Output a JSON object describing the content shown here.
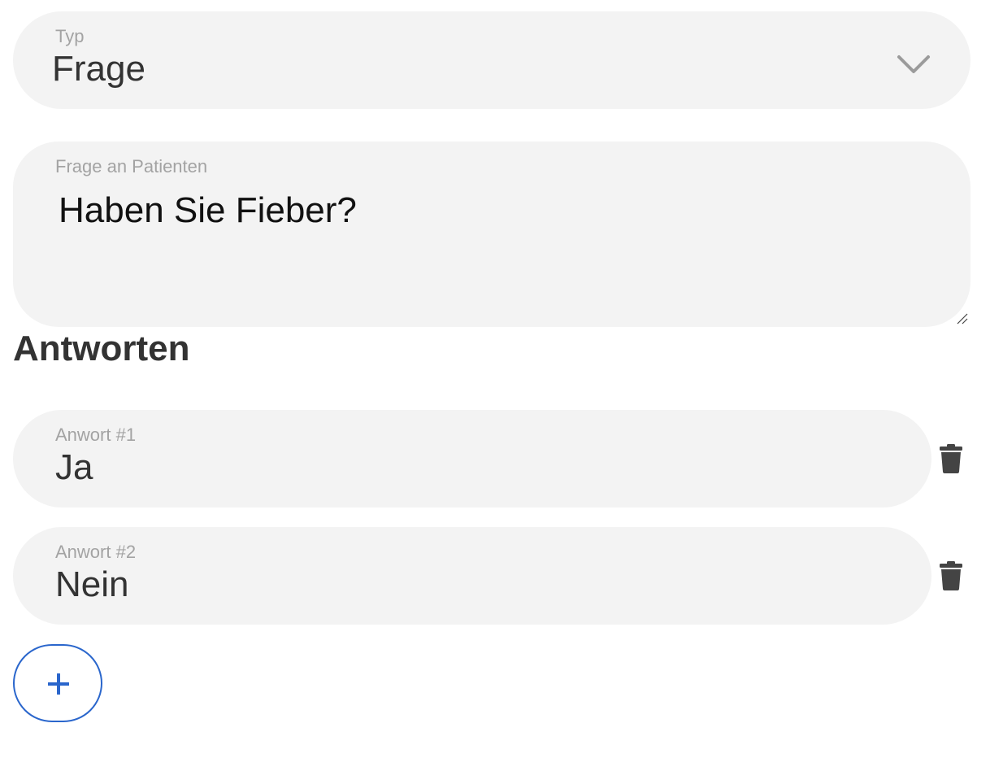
{
  "type_select": {
    "label": "Typ",
    "value": "Frage",
    "icon": "chevron-down-icon"
  },
  "question": {
    "label": "Frage an Patienten",
    "value": "Haben Sie Fieber?"
  },
  "answers_section": {
    "heading": "Antworten"
  },
  "answers": [
    {
      "label": "Anwort #1",
      "value": "Ja",
      "delete_icon": "trash-icon"
    },
    {
      "label": "Anwort #2",
      "value": "Nein",
      "delete_icon": "trash-icon"
    }
  ],
  "add_answer": {
    "icon": "plus-icon"
  },
  "colors": {
    "field_background": "#f3f3f3",
    "label_text": "#a3a3a3",
    "value_text": "#333333",
    "accent": "#2a66cc"
  }
}
